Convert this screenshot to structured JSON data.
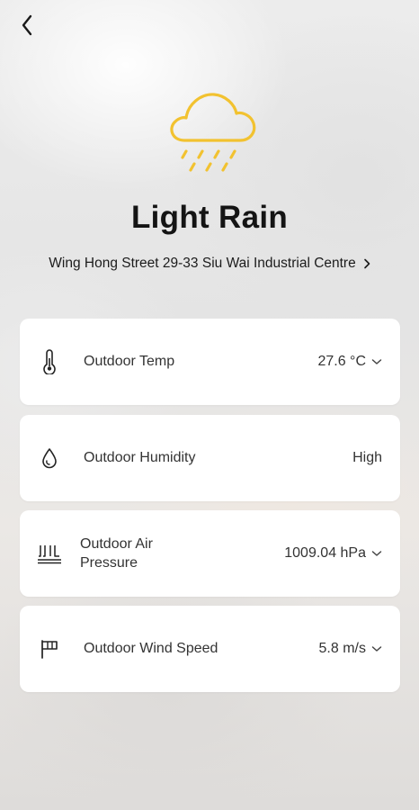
{
  "weather": {
    "condition": "Light Rain",
    "icon": "light-rain-cloud-icon",
    "accent_color": "#F2C230"
  },
  "location": {
    "address": "Wing Hong Street 29-33 Siu Wai Industrial Centre"
  },
  "metrics": [
    {
      "label": "Outdoor Temp",
      "value": "27.6 °C",
      "icon": "thermometer-icon",
      "has_dropdown": true
    },
    {
      "label": "Outdoor Humidity",
      "value": "High",
      "icon": "water-drop-icon",
      "has_dropdown": false
    },
    {
      "label": "Outdoor Air Pressure",
      "value": "1009.04 hPa",
      "icon": "air-pressure-icon",
      "has_dropdown": true
    },
    {
      "label": "Outdoor Wind Speed",
      "value": "5.8 m/s",
      "icon": "wind-flag-icon",
      "has_dropdown": true
    }
  ]
}
